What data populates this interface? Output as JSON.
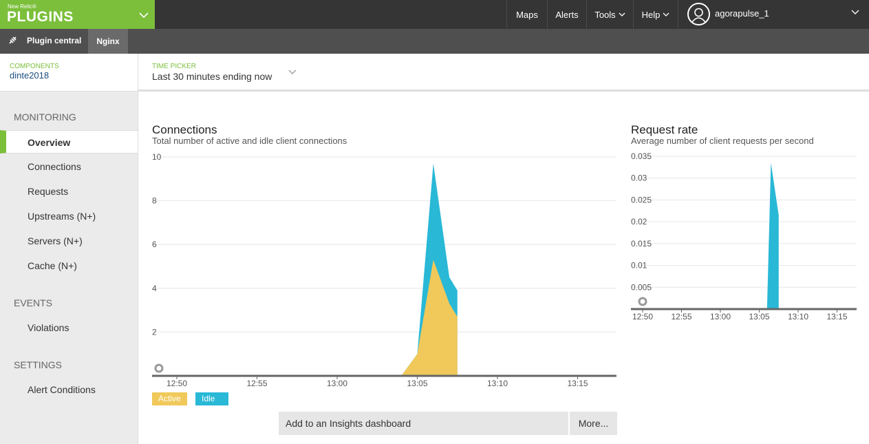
{
  "brand": {
    "small": "New Relic®",
    "name": "PLUGINS"
  },
  "topnav": {
    "maps": "Maps",
    "alerts": "Alerts",
    "tools": "Tools",
    "help": "Help",
    "username": "agorapulse_1"
  },
  "subnav": {
    "plugin_central": "Plugin central",
    "current": "Nginx"
  },
  "components": {
    "label": "COMPONENTS",
    "value": "dinte2018"
  },
  "time_picker": {
    "label": "TIME PICKER",
    "value": "Last 30 minutes ending now"
  },
  "sidebar": {
    "monitoring": "MONITORING",
    "items": [
      "Overview",
      "Connections",
      "Requests",
      "Upstreams (N+)",
      "Servers (N+)",
      "Cache (N+)"
    ],
    "events": "EVENTS",
    "events_items": [
      "Violations"
    ],
    "settings": "SETTINGS",
    "settings_items": [
      "Alert Conditions"
    ]
  },
  "connections_chart": {
    "title": "Connections",
    "subtitle": "Total number of active and idle client connections"
  },
  "request_chart": {
    "title": "Request rate",
    "subtitle": "Average number of client requests per second"
  },
  "legend": {
    "active": "Active",
    "idle": "Idle"
  },
  "actions": {
    "add": "Add to an Insights dashboard",
    "more": "More..."
  },
  "colors": {
    "brand": "#7bbf3b",
    "active": "#f0c95a",
    "idle": "#29b8d6"
  },
  "chart_data": [
    {
      "type": "area",
      "title": "Connections",
      "subtitle": "Total number of active and idle client connections",
      "x_ticks": [
        "12:50",
        "12:55",
        "13:00",
        "13:05",
        "13:10",
        "13:15"
      ],
      "y_ticks": [
        "2",
        "4",
        "6",
        "8",
        "10"
      ],
      "ylim": [
        0,
        10
      ],
      "x_minutes": [
        14,
        15,
        16,
        17,
        17.5
      ],
      "series": [
        {
          "name": "Active",
          "values": [
            0,
            1,
            5.3,
            3.3,
            2.7
          ]
        },
        {
          "name": "Idle",
          "values": [
            0,
            1,
            9.7,
            4.5,
            3.9
          ]
        }
      ]
    },
    {
      "type": "area",
      "title": "Request rate",
      "subtitle": "Average number of client requests per second",
      "x_ticks": [
        "12:50",
        "12:55",
        "13:00",
        "13:05",
        "13:10",
        "13:15"
      ],
      "y_ticks": [
        "0.005",
        "0.01",
        "0.015",
        "0.02",
        "0.025",
        "0.03",
        "0.035"
      ],
      "ylim": [
        0,
        0.035
      ],
      "x_minutes": [
        16,
        16.5,
        17.5
      ],
      "series": [
        {
          "name": "Idle",
          "values": [
            0,
            0.0335,
            0.0215
          ]
        }
      ]
    }
  ]
}
